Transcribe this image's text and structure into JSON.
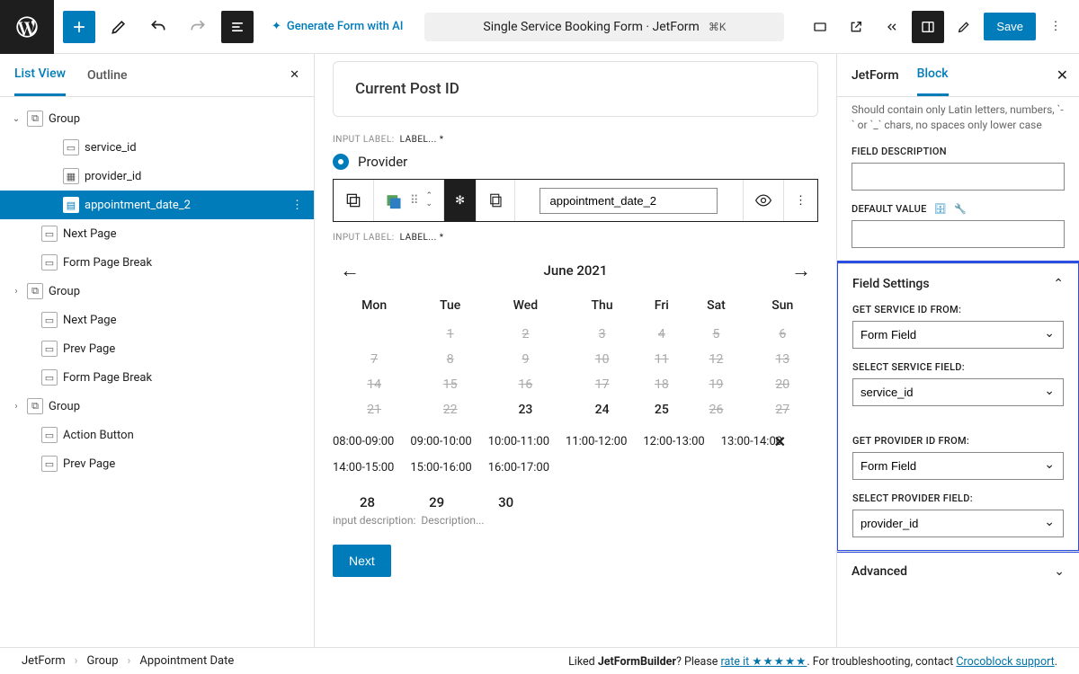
{
  "topbar": {
    "generate_ai": "Generate Form with AI",
    "doc_title": "Single Service Booking Form · JetForm",
    "shortcut": "⌘K",
    "save": "Save"
  },
  "left_panel": {
    "tabs": {
      "list_view": "List View",
      "outline": "Outline"
    },
    "tree": [
      {
        "label": "Group",
        "indent": 0,
        "chev": "⌄",
        "icon": "⧉"
      },
      {
        "label": "service_id",
        "indent": 2,
        "icon": "▭"
      },
      {
        "label": "provider_id",
        "indent": 2,
        "icon": "▦"
      },
      {
        "label": "appointment_date_2",
        "indent": 2,
        "icon": "▤",
        "selected": true
      },
      {
        "label": "Next Page",
        "indent": 1,
        "icon": "▭"
      },
      {
        "label": "Form Page Break",
        "indent": 1,
        "icon": "▭"
      },
      {
        "label": "Group",
        "indent": 0,
        "chev": "›",
        "icon": "⧉"
      },
      {
        "label": "Next Page",
        "indent": 1,
        "icon": "▭"
      },
      {
        "label": "Prev Page",
        "indent": 1,
        "icon": "▭"
      },
      {
        "label": "Form Page Break",
        "indent": 1,
        "icon": "▭"
      },
      {
        "label": "Group",
        "indent": 0,
        "chev": "›",
        "icon": "⧉"
      },
      {
        "label": "Action Button",
        "indent": 1,
        "icon": "▭"
      },
      {
        "label": "Prev Page",
        "indent": 1,
        "icon": "▭"
      }
    ]
  },
  "canvas": {
    "card_title": "Current Post ID",
    "input_label_prefix": "INPUT LABEL:",
    "label_placeholder": "LABEL... *",
    "provider_label": "Provider",
    "block_name": "appointment_date_2",
    "calendar": {
      "title": "June 2021",
      "days": [
        "Mon",
        "Tue",
        "Wed",
        "Thu",
        "Fri",
        "Sat",
        "Sun"
      ],
      "rows": [
        [
          {
            "d": "",
            "o": 0
          },
          {
            "d": "1",
            "o": 0
          },
          {
            "d": "2",
            "o": 0
          },
          {
            "d": "3",
            "o": 0
          },
          {
            "d": "4",
            "o": 0
          },
          {
            "d": "5",
            "o": 0
          },
          {
            "d": "6",
            "o": 0
          }
        ],
        [
          {
            "d": "7",
            "o": 0
          },
          {
            "d": "8",
            "o": 0
          },
          {
            "d": "9",
            "o": 0
          },
          {
            "d": "10",
            "o": 0
          },
          {
            "d": "11",
            "o": 0
          },
          {
            "d": "12",
            "o": 0
          },
          {
            "d": "13",
            "o": 0
          }
        ],
        [
          {
            "d": "14",
            "o": 0
          },
          {
            "d": "15",
            "o": 0
          },
          {
            "d": "16",
            "o": 0
          },
          {
            "d": "17",
            "o": 0
          },
          {
            "d": "18",
            "o": 0
          },
          {
            "d": "19",
            "o": 0
          },
          {
            "d": "20",
            "o": 0
          }
        ],
        [
          {
            "d": "21",
            "o": 0
          },
          {
            "d": "22",
            "o": 0
          },
          {
            "d": "23",
            "o": 1
          },
          {
            "d": "24",
            "o": 1
          },
          {
            "d": "25",
            "o": 1
          },
          {
            "d": "26",
            "o": 0
          },
          {
            "d": "27",
            "o": 0
          }
        ]
      ]
    },
    "slots_row1": [
      "08:00-09:00",
      "09:00-10:00",
      "10:00-11:00",
      "11:00-12:00",
      "12:00-13:00",
      "13:00-14:00"
    ],
    "slots_row2": [
      "14:00-15:00",
      "15:00-16:00",
      "16:00-17:00"
    ],
    "next_dates": [
      "28",
      "29",
      "30"
    ],
    "desc_prefix": "input description:",
    "desc_placeholder": "Description...",
    "next_btn": "Next"
  },
  "right_panel": {
    "tabs": {
      "jetform": "JetForm",
      "block": "Block"
    },
    "help": "Should contain only Latin letters, numbers, `-` or `_` chars, no spaces only lower case",
    "field_desc_label": "FIELD DESCRIPTION",
    "default_value_label": "DEFAULT VALUE",
    "field_settings_title": "Field Settings",
    "get_service_label": "GET SERVICE ID FROM:",
    "get_service_value": "Form Field",
    "select_service_label": "SELECT SERVICE FIELD:",
    "select_service_value": "service_id",
    "get_provider_label": "GET PROVIDER ID FROM:",
    "get_provider_value": "Form Field",
    "select_provider_label": "SELECT PROVIDER FIELD:",
    "select_provider_value": "provider_id",
    "advanced_title": "Advanced"
  },
  "footer": {
    "crumbs": [
      "JetForm",
      "Group",
      "Appointment Date"
    ],
    "liked_prefix": "Liked ",
    "liked_bold": "JetFormBuilder",
    "liked_suffix": "? Please ",
    "rate_link": "rate it ",
    "stars": "★★★★★",
    "trouble": ". For troubleshooting, contact ",
    "support_link": "Crocoblock support",
    "period": "."
  }
}
